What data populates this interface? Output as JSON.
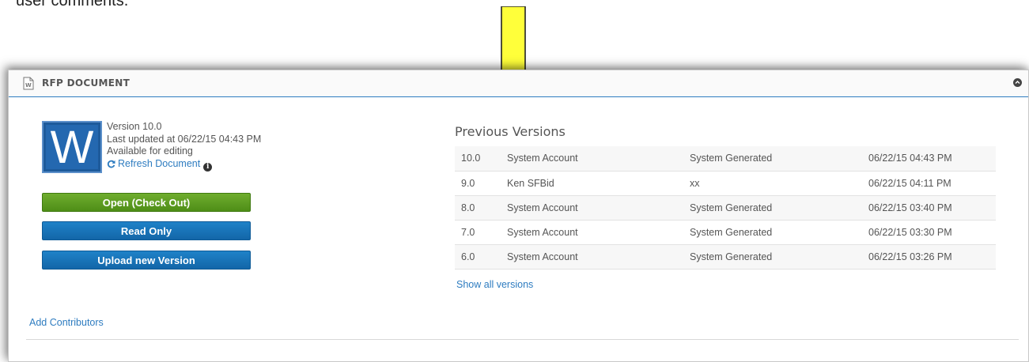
{
  "caption": "user comments.",
  "panel": {
    "title": "RFP DOCUMENT"
  },
  "document": {
    "icon_letter": "W",
    "version": "Version 10.0",
    "last_updated": "Last updated at 06/22/15 04:43 PM",
    "availability": "Available for editing",
    "refresh_label": "Refresh Document",
    "refresh_icon": "refresh-icon",
    "info_icon": "info-icon"
  },
  "buttons": {
    "open": "Open (Check Out)",
    "read_only": "Read Only",
    "upload": "Upload new Version"
  },
  "colors": {
    "accent": "#2e7cc0",
    "open_button": "#5b9c20",
    "blue_button": "#1a75bb",
    "arrow": "#ffff3a"
  },
  "add_contributors": "Add Contributors",
  "versions": {
    "title": "Previous Versions",
    "rows": [
      {
        "version": "10.0",
        "author": "System Account",
        "comment": "System Generated",
        "date": "06/22/15 04:43 PM"
      },
      {
        "version": "9.0",
        "author": "Ken SFBid",
        "comment": "xx",
        "date": "06/22/15 04:11 PM"
      },
      {
        "version": "8.0",
        "author": "System Account",
        "comment": "System Generated",
        "date": "06/22/15 03:40 PM"
      },
      {
        "version": "7.0",
        "author": "System Account",
        "comment": "System Generated",
        "date": "06/22/15 03:30 PM"
      },
      {
        "version": "6.0",
        "author": "System Account",
        "comment": "System Generated",
        "date": "06/22/15 03:26 PM"
      }
    ],
    "show_all": "Show all versions"
  }
}
